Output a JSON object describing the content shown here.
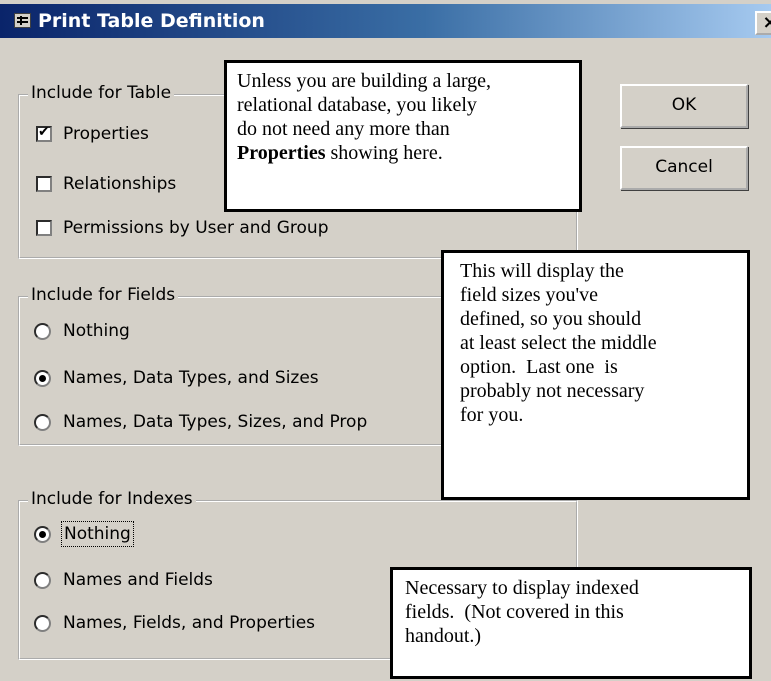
{
  "window": {
    "title": "Print Table Definition",
    "close_glyph": "×"
  },
  "table_group": {
    "legend": "Include for Table",
    "options": [
      {
        "label": "Properties",
        "checked": true
      },
      {
        "label": "Relationships",
        "checked": false
      },
      {
        "label": "Permissions by User and Group",
        "checked": false
      }
    ]
  },
  "fields_group": {
    "legend": "Include for Fields",
    "options": [
      {
        "label": "Nothing",
        "selected": false
      },
      {
        "label": "Names, Data Types, and Sizes",
        "selected": true
      },
      {
        "label": "Names, Data Types, Sizes, and Prop",
        "selected": false
      }
    ]
  },
  "indexes_group": {
    "legend": "Include for Indexes",
    "options": [
      {
        "label": "Nothing",
        "selected": true
      },
      {
        "label": "Names and Fields",
        "selected": false
      },
      {
        "label": "Names, Fields, and Properties",
        "selected": false
      }
    ]
  },
  "buttons": {
    "ok": "OK",
    "cancel": "Cancel"
  },
  "callouts": {
    "properties": {
      "line1": "Unless you are building a large,",
      "line2": "relational database, you likely",
      "line3": "do not need any more than",
      "bold": "Properties",
      "rest": " showing here."
    },
    "fields": {
      "line1": "This will display the",
      "line2": "field sizes you've",
      "line3": "defined, so you should",
      "line4": "at least select the middle",
      "line5": "option.  Last one  is",
      "line6": "probably not necessary",
      "line7": "for you."
    },
    "indexes": {
      "line1": "Necessary to display indexed",
      "line2": "fields.  (Not covered in this",
      "line3": "handout.)"
    }
  }
}
